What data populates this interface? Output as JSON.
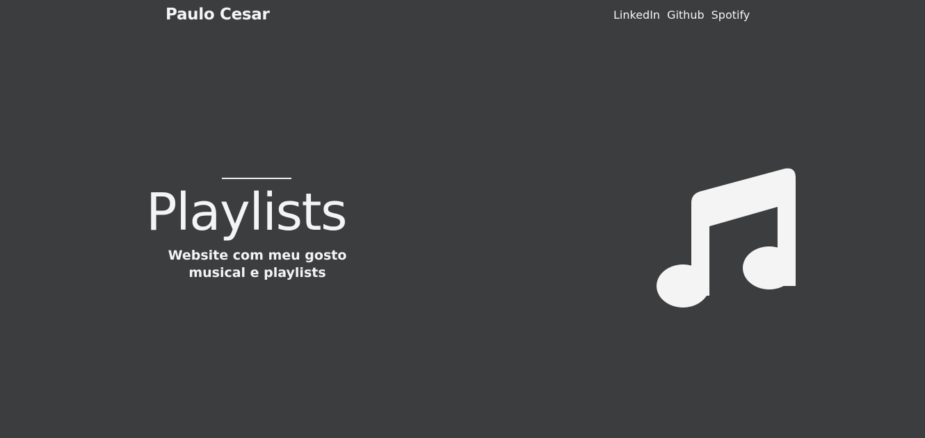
{
  "header": {
    "brand": "Paulo Cesar",
    "nav": [
      {
        "label": "LinkedIn"
      },
      {
        "label": "Github"
      },
      {
        "label": "Spotify"
      }
    ]
  },
  "hero": {
    "title": "Playlists",
    "subtitle": "Website com meu gosto musical e playlists",
    "icon": "music-note-icon"
  },
  "colors": {
    "background": "#3c3d3f",
    "text": "#f4f4f4"
  }
}
